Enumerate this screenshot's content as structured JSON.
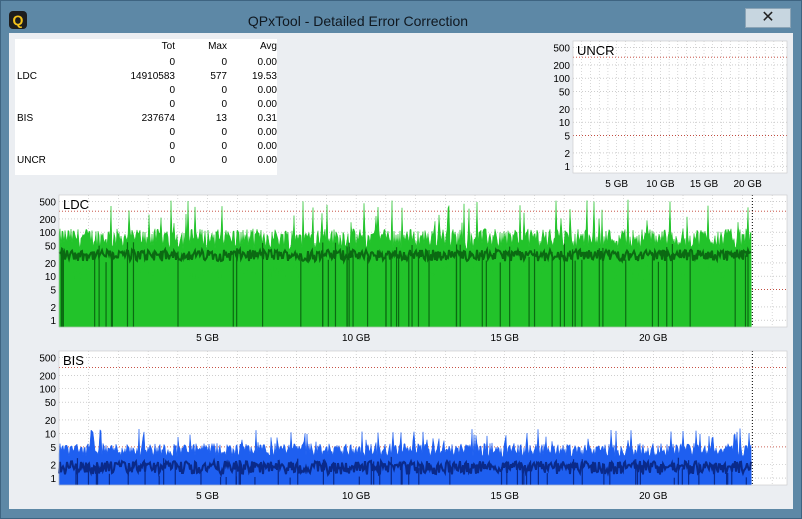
{
  "window": {
    "title": "QPxTool - Detailed Error Correction",
    "icon_letter": "Q",
    "close_glyph": "✕"
  },
  "stats": {
    "headers": [
      "",
      "Tot",
      "Max",
      "Avg"
    ],
    "rows": [
      [
        "",
        "0",
        "0",
        "0.00"
      ],
      [
        "LDC",
        "14910583",
        "577",
        "19.53"
      ],
      [
        "",
        "0",
        "0",
        "0.00"
      ],
      [
        "",
        "0",
        "0",
        "0.00"
      ],
      [
        "BIS",
        "237674",
        "13",
        "0.31"
      ],
      [
        "",
        "0",
        "0",
        "0.00"
      ],
      [
        "",
        "0",
        "0",
        "0.00"
      ],
      [
        "UNCR",
        "0",
        "0",
        "0.00"
      ]
    ]
  },
  "colors": {
    "ldc_light": "#22c32a",
    "ldc_dark": "#0b6a12",
    "bis_light": "#1e5ff0",
    "bis_dark": "#0a2a8a",
    "gridline": "#b0b0b0",
    "threshold": "#c0392b"
  },
  "chart_data": [
    {
      "type": "area",
      "label": "UNCR",
      "y_scale": "log",
      "y_ticks": [
        "500",
        "200",
        "100",
        "50",
        "20",
        "10",
        "5",
        "2",
        "1"
      ],
      "x_ticks": [
        "5 GB",
        "10 GB",
        "15 GB",
        "20 GB"
      ],
      "x_range_gb": [
        0,
        24.5
      ],
      "series": [
        {
          "values": []
        }
      ]
    },
    {
      "type": "area",
      "label": "LDC",
      "y_scale": "log",
      "y_ticks": [
        "500",
        "200",
        "100",
        "50",
        "20",
        "10",
        "5",
        "2",
        "1"
      ],
      "x_ticks": [
        "5 GB",
        "10 GB",
        "15 GB",
        "20 GB"
      ],
      "x_range_gb": [
        0,
        24.5
      ],
      "data_end_gb": 23.3,
      "series": [
        {
          "values_summary": "max per interval ~100-500, average ~30"
        }
      ]
    },
    {
      "type": "area",
      "label": "BIS",
      "y_scale": "log",
      "y_ticks": [
        "500",
        "200",
        "100",
        "50",
        "20",
        "10",
        "5",
        "2",
        "1"
      ],
      "x_ticks": [
        "5 GB",
        "10 GB",
        "15 GB",
        "20 GB"
      ],
      "x_range_gb": [
        0,
        24.5
      ],
      "data_end_gb": 23.3,
      "series": [
        {
          "values_summary": "max per interval ~5-13, typically ~4"
        }
      ]
    }
  ]
}
